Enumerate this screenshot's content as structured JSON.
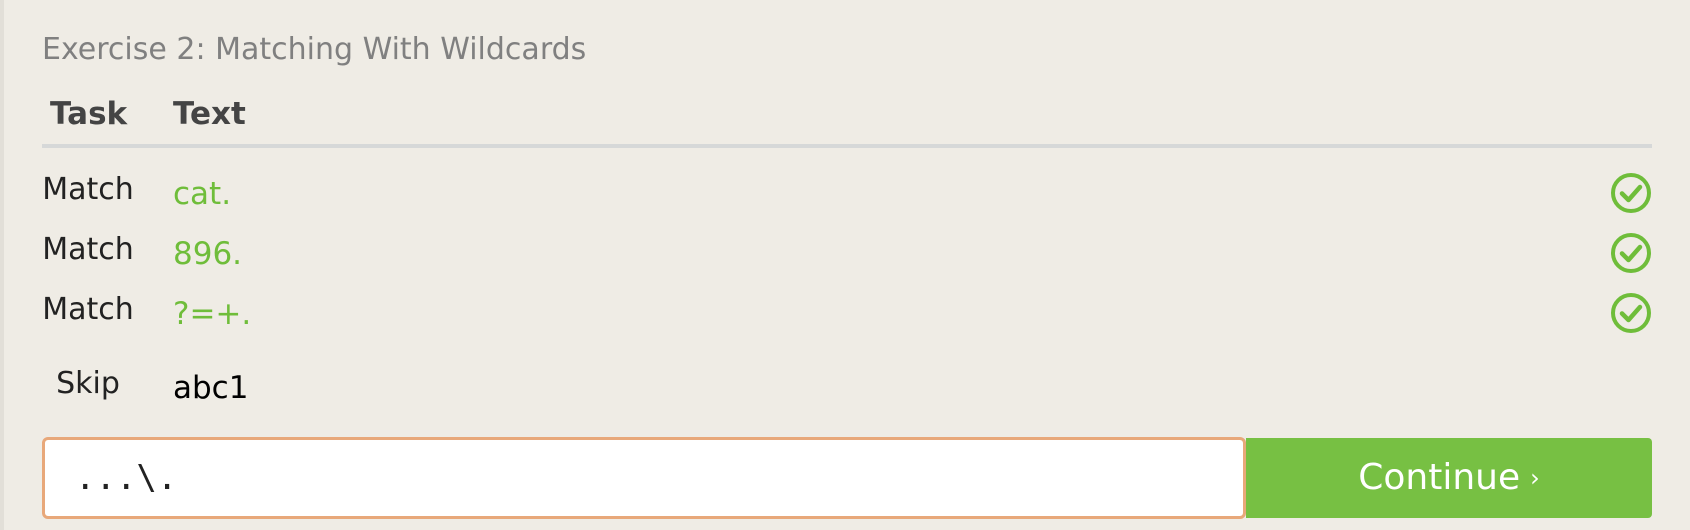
{
  "exercise": {
    "title": "Exercise 2: Matching With Wildcards"
  },
  "table": {
    "headers": {
      "task": "Task",
      "text": "Text"
    },
    "rows": [
      {
        "task": "Match",
        "text": "cat.",
        "status": "success"
      },
      {
        "task": "Match",
        "text": "896.",
        "status": "success"
      },
      {
        "task": "Match",
        "text": "?=+.",
        "status": "success"
      },
      {
        "task": "Skip",
        "text": "abc1",
        "status": "none"
      }
    ]
  },
  "answer": {
    "value": "...\\."
  },
  "continue_button": {
    "label": "Continue",
    "chevron": "›"
  },
  "colors": {
    "success_green": "#6fbd3a",
    "button_green": "#77c043",
    "input_border": "#e8a87a",
    "background": "#efece5"
  },
  "icons": {
    "success": "check-circle-icon"
  }
}
